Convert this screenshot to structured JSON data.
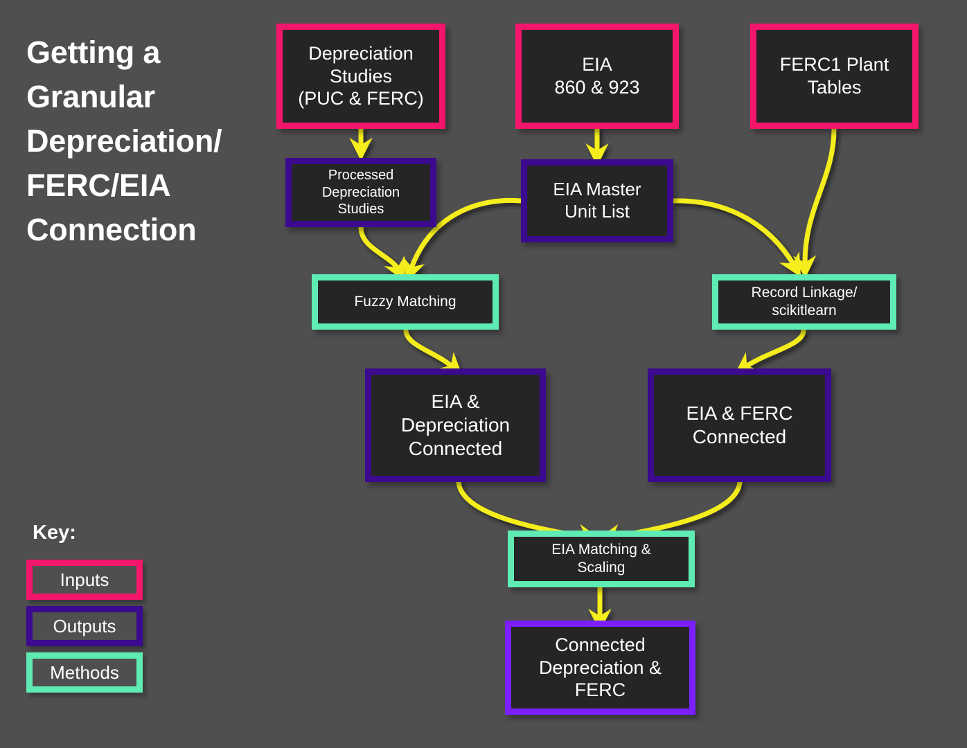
{
  "page": {
    "title": "Getting a\nGranular\nDepreciation/\nFERC/EIA\nConnection",
    "background_color": "#4f4f4f",
    "node_fill_color": "#252525",
    "text_color": "#ffffff",
    "arrow_color": "#f5ee1c"
  },
  "colors": {
    "inputs": "#f4156d",
    "outputs": "#3b0a8e",
    "methods": "#5fecb4",
    "final_output": "#7b1fff"
  },
  "nodes": {
    "depreciation_studies": {
      "label": "Depreciation\nStudies\n(PUC & FERC)",
      "category": "Inputs"
    },
    "eia_860_923": {
      "label": "EIA\n860 & 923",
      "category": "Inputs"
    },
    "ferc1_plant_tables": {
      "label": "FERC1 Plant\nTables",
      "category": "Inputs"
    },
    "processed_depreciation_studies": {
      "label": "Processed\nDepreciation\nStudies",
      "category": "Outputs"
    },
    "eia_master_unit_list": {
      "label": "EIA Master\nUnit List",
      "category": "Outputs"
    },
    "fuzzy_matching": {
      "label": "Fuzzy Matching",
      "category": "Methods"
    },
    "record_linkage": {
      "label": "Record Linkage/\nscikitlearn",
      "category": "Methods"
    },
    "eia_depreciation_connected": {
      "label": "EIA &\nDepreciation\nConnected",
      "category": "Outputs"
    },
    "eia_ferc_connected": {
      "label": "EIA & FERC\nConnected",
      "category": "Outputs"
    },
    "eia_matching_scaling": {
      "label": "EIA Matching &\nScaling",
      "category": "Methods"
    },
    "connected_depreciation_ferc": {
      "label": "Connected\nDepreciation &\nFERC",
      "category": "Outputs"
    }
  },
  "key": {
    "heading": "Key:",
    "items": [
      {
        "label": "Inputs",
        "color": "#f4156d"
      },
      {
        "label": "Outputs",
        "color": "#3b0a8e"
      },
      {
        "label": "Methods",
        "color": "#5fecb4"
      }
    ]
  },
  "edges": [
    {
      "from": "depreciation_studies",
      "to": "processed_depreciation_studies"
    },
    {
      "from": "eia_860_923",
      "to": "eia_master_unit_list"
    },
    {
      "from": "ferc1_plant_tables",
      "to": "record_linkage"
    },
    {
      "from": "processed_depreciation_studies",
      "to": "fuzzy_matching"
    },
    {
      "from": "eia_master_unit_list",
      "to": "fuzzy_matching"
    },
    {
      "from": "eia_master_unit_list",
      "to": "record_linkage"
    },
    {
      "from": "fuzzy_matching",
      "to": "eia_depreciation_connected"
    },
    {
      "from": "record_linkage",
      "to": "eia_ferc_connected"
    },
    {
      "from": "eia_depreciation_connected",
      "to": "eia_matching_scaling"
    },
    {
      "from": "eia_ferc_connected",
      "to": "eia_matching_scaling"
    },
    {
      "from": "eia_matching_scaling",
      "to": "connected_depreciation_ferc"
    }
  ]
}
